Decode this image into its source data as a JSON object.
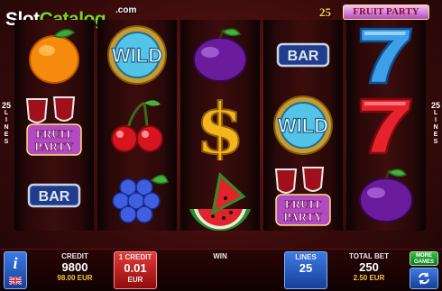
{
  "header": {
    "watermark_main": "Slot",
    "watermark_accent": "Catalog",
    "watermark_suffix": ".com",
    "brand_number": "25",
    "brand_name": "FRUIT PARTY"
  },
  "side_markers": {
    "left": {
      "number": "25",
      "letters": [
        "L",
        "I",
        "N",
        "E",
        "S"
      ]
    },
    "right": {
      "number": "25",
      "letters": [
        "L",
        "I",
        "N",
        "E",
        "S"
      ]
    }
  },
  "reels": [
    [
      "orange",
      "wine-glasses",
      "bar"
    ],
    [
      "wild",
      "cherries",
      "grapes"
    ],
    [
      "plum",
      "dollar",
      "watermelon"
    ],
    [
      "bar",
      "wild",
      "wine-glasses"
    ],
    [
      "seven",
      "seven",
      "plum"
    ]
  ],
  "symbol_text": {
    "wild": "WILD",
    "bar": "BAR",
    "fruit": "FRUIT",
    "party": "PARTY"
  },
  "bottom_bar": {
    "info_label": "i",
    "credit_label": "CREDIT",
    "credit_value": "9800",
    "credit_sub": "98.00 EUR",
    "coin_label": "1 CREDIT",
    "coin_value": "0.01",
    "coin_currency": "EUR",
    "win_label": "WIN",
    "lines_label": "LINES",
    "lines_value": "25",
    "bet_label": "TOTAL BET",
    "bet_value": "250",
    "bet_sub": "2.50 EUR",
    "more_games_line1": "MORE",
    "more_games_line2": "GAMES"
  },
  "colors": {
    "background": "#3a0b0b",
    "blue_button": "#2a5cc0",
    "red_button": "#c41e1e",
    "green_button": "#2aa83c",
    "gold": "#f3c640"
  }
}
